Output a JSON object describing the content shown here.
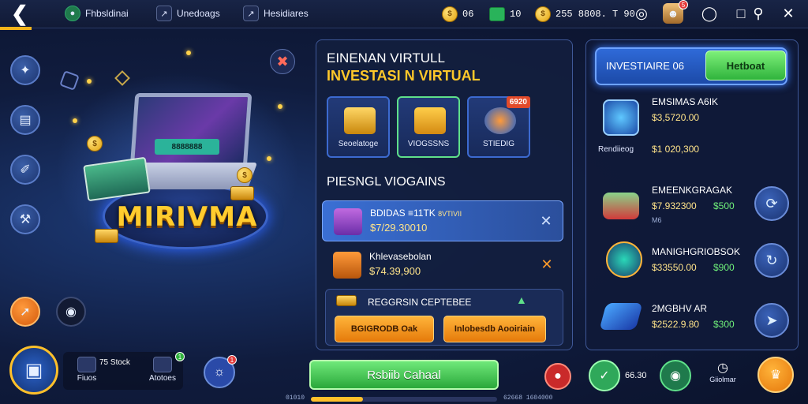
{
  "topbar": {
    "back_icon": "back-arrow-icon",
    "nav": [
      {
        "label": "Fhbsldinai",
        "icon": "globe-icon"
      },
      {
        "label": "Unedoags",
        "icon": "chart-icon"
      },
      {
        "label": "Hesidiares",
        "icon": "chart-icon"
      }
    ],
    "resources": {
      "coins": "06",
      "gems": "10",
      "gold": "255 8808. T 90"
    },
    "notification_count": "5"
  },
  "hero": {
    "title": "MIRIVMA",
    "screen_label": "8888888"
  },
  "center": {
    "title_line1": "EINENAN VIRTULL",
    "title_line2": "INVESTASI N VIRTUAL",
    "categories": [
      {
        "label": "Seoelatoge",
        "badge": ""
      },
      {
        "label": "VIOGSSNS",
        "badge": ""
      },
      {
        "label": "STIEDIG",
        "badge": "6920"
      }
    ],
    "section_title": "PIESNGL VIOGAINS",
    "investments": [
      {
        "name": "BDIDAS  ≡11TK",
        "tag": "8VTIVII",
        "price": "$7/29.30010"
      },
      {
        "name": "Khlevasebolan",
        "price": "$74.39,900"
      }
    ],
    "sub_panel": {
      "title": "REGGRSIN CEPTEBEE",
      "button1": "BGIGRODB Oak",
      "button2": "Inlobesdb Aooiriain"
    }
  },
  "right": {
    "header_title": "INVESTIAIRE 06",
    "header_button": "Hetboat",
    "assets": [
      {
        "name": "EMSIMAS A6IK",
        "price": "$3,5720.00",
        "sub_label": "Rendiieog",
        "sub_price": "$1 020,300",
        "green": ""
      },
      {
        "name": "EMEENKGRAGAK",
        "price": "$7.932300",
        "sub_label": "M6",
        "sub_price": "",
        "green": "$500"
      },
      {
        "name": "MANIGHGRIOBSOK",
        "price": "$33550.00",
        "sub_label": "",
        "sub_price": "",
        "green": "$900"
      },
      {
        "name": "2MGBHV AR",
        "price": "$2522.9.80",
        "sub_label": "",
        "sub_price": "",
        "green": "$300"
      }
    ]
  },
  "bottom": {
    "item1_label": "Fiuos",
    "item1_count": "75 Stock",
    "item2_label": "Atotoes",
    "item2_badge": "1",
    "center_button": "Rsbiib Cahaal",
    "progress": 0.28,
    "progress_left_label": "01010",
    "progress_right_label": "62668 1604000",
    "counter": "66.30",
    "settings_label": "Giiolmar",
    "notif_badge": "1"
  }
}
